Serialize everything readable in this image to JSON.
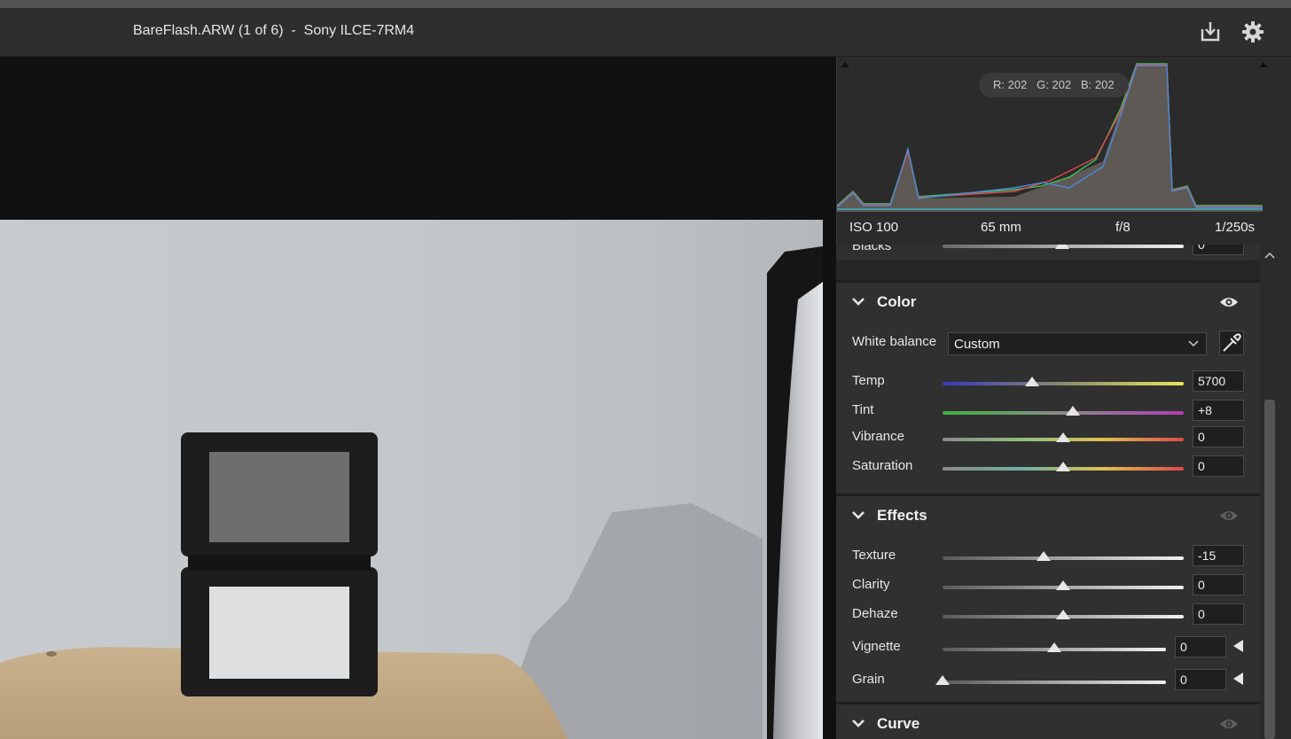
{
  "titlebar": {
    "title": "BareFlash.ARW (1 of 6)  -  Sony ILCE-7RM4",
    "icons": [
      "download-icon",
      "gear-icon"
    ]
  },
  "histogram": {
    "readout": "R: 202   G: 202   B: 202",
    "exif": {
      "iso": "ISO 100",
      "focal": "65 mm",
      "aperture": "f/8",
      "shutter": "1/250s"
    }
  },
  "partial_row": {
    "label": "Blacks",
    "value": "0"
  },
  "color": {
    "title": "Color",
    "white_balance_label": "White balance",
    "white_balance_value": "Custom",
    "sliders": [
      {
        "label": "Temp",
        "value": "5700",
        "position": 0.37
      },
      {
        "label": "Tint",
        "value": "+8",
        "position": 0.54
      },
      {
        "label": "Vibrance",
        "value": "0",
        "position": 0.5
      },
      {
        "label": "Saturation",
        "value": "0",
        "position": 0.5
      }
    ]
  },
  "effects": {
    "title": "Effects",
    "sliders": [
      {
        "label": "Texture",
        "value": "-15",
        "position": 0.42
      },
      {
        "label": "Clarity",
        "value": "0",
        "position": 0.5
      },
      {
        "label": "Dehaze",
        "value": "0",
        "position": 0.5
      },
      {
        "label": "Vignette",
        "value": "0",
        "position": 0.5
      },
      {
        "label": "Grain",
        "value": "0",
        "position": 0.0
      }
    ]
  },
  "curve": {
    "title": "Curve"
  },
  "colors": {
    "accent": "#e6e6e6",
    "panel": "#303030",
    "titlebar": "#2e2e2e"
  }
}
